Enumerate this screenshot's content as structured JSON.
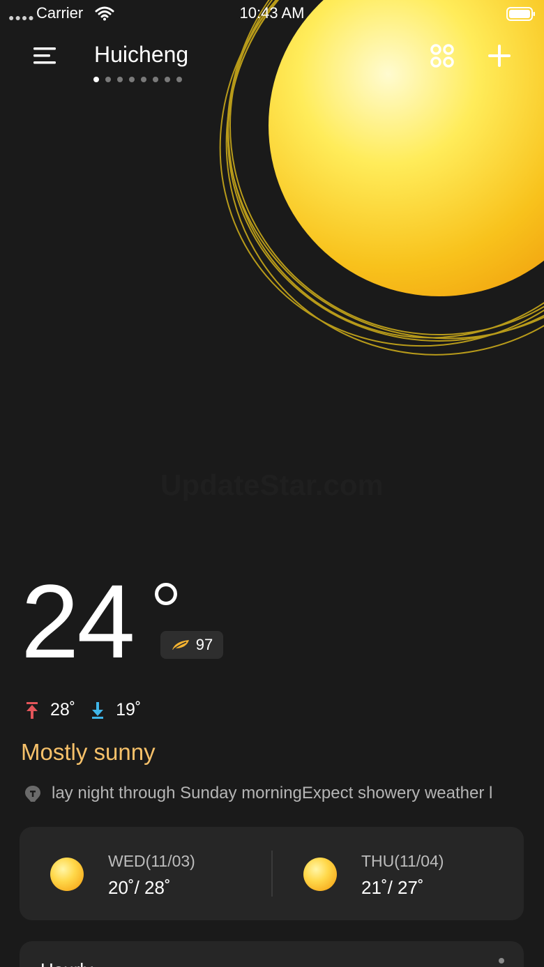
{
  "status_bar": {
    "carrier": "Carrier",
    "time": "10:43 AM"
  },
  "header": {
    "city": "Huicheng",
    "page_count": 8,
    "active_page": 1
  },
  "watermark": "UpdateStar.com",
  "current": {
    "temperature": "24",
    "aqi": "97",
    "high": "28˚",
    "low": "19˚",
    "condition": "Mostly sunny",
    "alert_text": "lay night through Sunday morningExpect showery weather l"
  },
  "forecast": [
    {
      "label": "WED(11/03)",
      "range": "20˚/ 28˚",
      "icon": "sun-icon"
    },
    {
      "label": "THU(11/04)",
      "range": "21˚/ 27˚",
      "icon": "sun-icon"
    }
  ],
  "hourly": {
    "title": "Hourly"
  },
  "colors": {
    "background": "#1a1a1a",
    "card": "#262626",
    "condition": "#f6c16a",
    "high_arrow": "#e3555a",
    "low_arrow": "#3fb5e8",
    "sun": "#ffd84a"
  }
}
